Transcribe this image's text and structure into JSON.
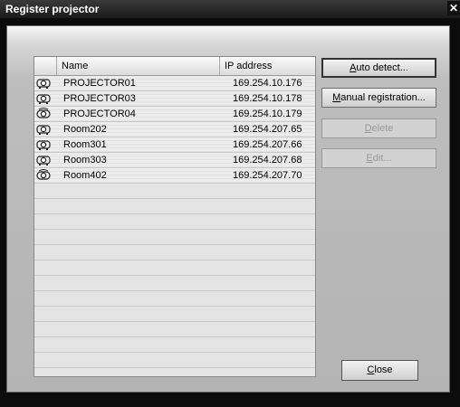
{
  "window": {
    "title": "Register projector"
  },
  "table": {
    "headers": {
      "name": "Name",
      "ip": "IP address"
    },
    "rows": [
      {
        "name": "PROJECTOR01",
        "ip": "169.254.10.176",
        "icon": "projector-icon"
      },
      {
        "name": "PROJECTOR03",
        "ip": "169.254.10.178",
        "icon": "projector-icon"
      },
      {
        "name": "PROJECTOR04",
        "ip": "169.254.10.179",
        "icon": "projector-network-icon"
      },
      {
        "name": "Room202",
        "ip": "169.254.207.65",
        "icon": "projector-icon"
      },
      {
        "name": "Room301",
        "ip": "169.254.207.66",
        "icon": "projector-icon"
      },
      {
        "name": "Room303",
        "ip": "169.254.207.68",
        "icon": "projector-icon"
      },
      {
        "name": "Room402",
        "ip": "169.254.207.70",
        "icon": "projector-network-icon"
      }
    ]
  },
  "buttons": {
    "auto_detect": {
      "label_u": "A",
      "label_rest": "uto detect..."
    },
    "manual": {
      "label_u": "M",
      "label_rest": "anual registration..."
    },
    "delete": {
      "label_u": "D",
      "label_rest": "elete",
      "enabled": false
    },
    "edit": {
      "label_u": "E",
      "label_rest": "dit...",
      "enabled": false
    },
    "close": {
      "label_u": "C",
      "label_rest": "lose"
    }
  }
}
